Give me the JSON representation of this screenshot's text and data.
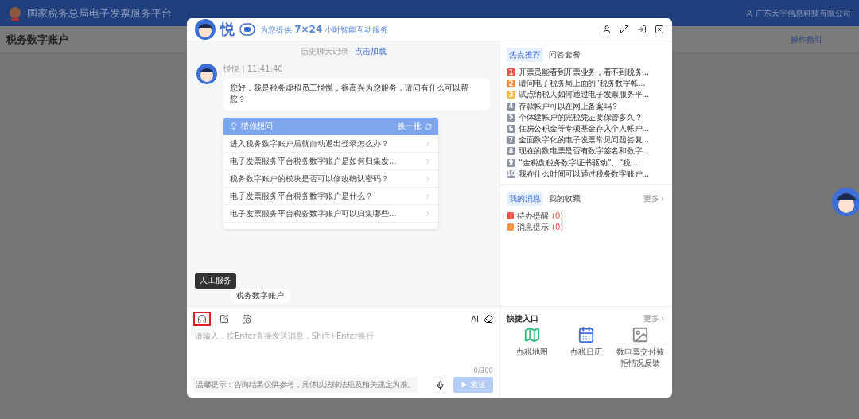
{
  "topbar": {
    "title": "国家税务总局电子发票服务平台",
    "company": "广东天宇信息科技有限公司"
  },
  "subheader": {
    "title": "税务数字账户",
    "link": "操作指引"
  },
  "chat": {
    "header": {
      "name": "悦",
      "tagline": "为您提供 **7×24** 小时智能互动服务"
    },
    "history": {
      "label": "历史聊天记录",
      "link": "点击加载"
    },
    "message": {
      "meta": "悦悦 | 11:41:40",
      "text": "您好，我是税务虚拟员工悦悦，很高兴为您服务，请问有什么可以帮您？"
    },
    "guess": {
      "title": "猜你想问",
      "refresh": "换一批",
      "items": [
        "进入税务数字账户后就自动退出登录怎么办？",
        "电子发票服务平台税务数字账户是如何归集发...",
        "税务数字账户的模块是否可以修改确认密码？",
        "电子发票服务平台税务数字账户是什么？",
        "电子发票服务平台税务数字账户可以归集哪些..."
      ]
    },
    "chip": "税务数字账户",
    "tooltip": "人工服务",
    "tools": [
      {
        "kind": "headset",
        "selected": true
      },
      {
        "kind": "edit",
        "selected": false
      },
      {
        "kind": "calendar",
        "selected": false
      }
    ],
    "ai": "AI",
    "input": {
      "placeholder": "请输入，按Enter直接发送消息，Shift+Enter换行",
      "counter": "0/300"
    },
    "notice": "温馨提示：咨询结果仅供参考，具体以法律法规及相关规定为准。",
    "send": {
      "label": "发送",
      "disabled": true
    }
  },
  "side": {
    "hot_tabs": [
      {
        "label": "热点推荐",
        "selected": true
      },
      {
        "label": "问答套餐",
        "selected": false
      }
    ],
    "hot_items": [
      {
        "num": "1",
        "text": "开票员能看到开票业务，看不到税务...",
        "color": "#e8574a"
      },
      {
        "num": "2",
        "text": "请问电子税务局上面的“税务数字帐...",
        "color": "#f0934a"
      },
      {
        "num": "3",
        "text": "试点纳税人如何通过电子发票服务平...",
        "color": "#f5bd4f"
      },
      {
        "num": "4",
        "text": "存款帐户可以在网上备案吗？",
        "color": "#8f95a3"
      },
      {
        "num": "5",
        "text": "个体建帐户的完税凭证要保管多久？",
        "color": "#8f95a3"
      },
      {
        "num": "6",
        "text": "住房公积金等专项基金存入个人帐户...",
        "color": "#8f95a3"
      },
      {
        "num": "7",
        "text": "全面数字化的电子发票常见问题答复...",
        "color": "#8f95a3"
      },
      {
        "num": "8",
        "text": "现在的数电票是否有数字签名和数字...",
        "color": "#8f95a3"
      },
      {
        "num": "9",
        "text": "“金税盘税务数字证书驱动”、“税...",
        "color": "#8f95a3"
      },
      {
        "num": "10",
        "text": "我在什么时间可以通过税务数字账户...",
        "color": "#8f95a3"
      }
    ],
    "msg_tabs": [
      {
        "label": "我的消息",
        "selected": true
      },
      {
        "label": "我的收藏",
        "selected": false
      }
    ],
    "msg_more": "更多",
    "messages": [
      {
        "label": "待办提醒",
        "count": "(0)",
        "color": "#e8574a"
      },
      {
        "label": "消息提示",
        "count": "(0)",
        "color": "#f0934a"
      }
    ],
    "quick": {
      "title": "快捷入口",
      "more": "更多",
      "items": [
        {
          "kind": "map",
          "label": "办税地图"
        },
        {
          "kind": "calendar",
          "label": "办税日历"
        },
        {
          "kind": "image",
          "label": "数电票交付被拒情况反馈"
        }
      ]
    }
  }
}
